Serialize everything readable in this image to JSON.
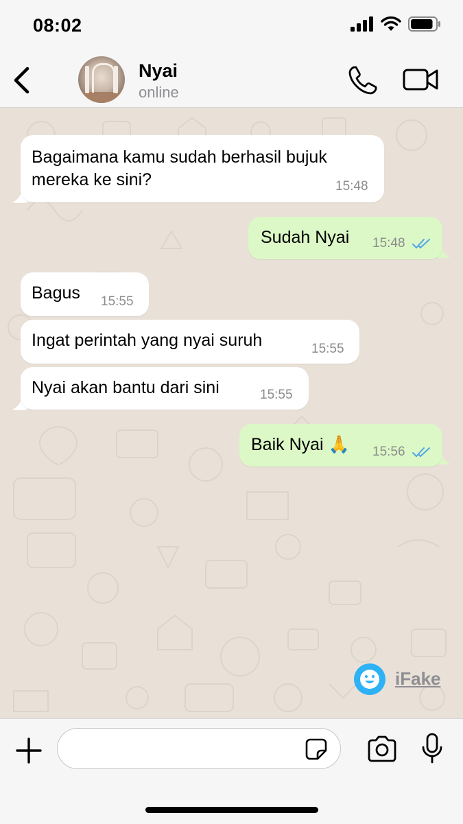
{
  "status_bar": {
    "time": "08:02",
    "battery_level": 0.9
  },
  "header": {
    "contact_name": "Nyai",
    "contact_status": "online",
    "icons": [
      "back-icon",
      "phone-icon",
      "video-camera-icon"
    ]
  },
  "messages": [
    {
      "direction": "incoming",
      "text": "Bagaimana kamu sudah berhasil bujuk\nmereka ke sini?",
      "time": "15:48"
    },
    {
      "direction": "outgoing",
      "text": "Sudah Nyai",
      "time": "15:48",
      "read": true
    },
    {
      "direction": "incoming",
      "text": "Bagus",
      "time": "15:55"
    },
    {
      "direction": "incoming",
      "text": "Ingat perintah yang nyai suruh",
      "time": "15:55"
    },
    {
      "direction": "incoming",
      "text": "Nyai akan bantu dari sini",
      "time": "15:55"
    },
    {
      "direction": "outgoing",
      "text": "Baik Nyai 🙏",
      "time": "15:56",
      "read": true
    }
  ],
  "watermark": {
    "text": "iFake"
  },
  "input_bar": {
    "placeholder": "",
    "icons": [
      "plus-icon",
      "sticker-icon",
      "camera-icon",
      "microphone-icon"
    ]
  },
  "colors": {
    "incoming_bubble": "#ffffff",
    "outgoing_bubble": "#dcf8c6",
    "read_ticks": "#4fa6e6",
    "wallpaper": "#e9e1d8"
  }
}
